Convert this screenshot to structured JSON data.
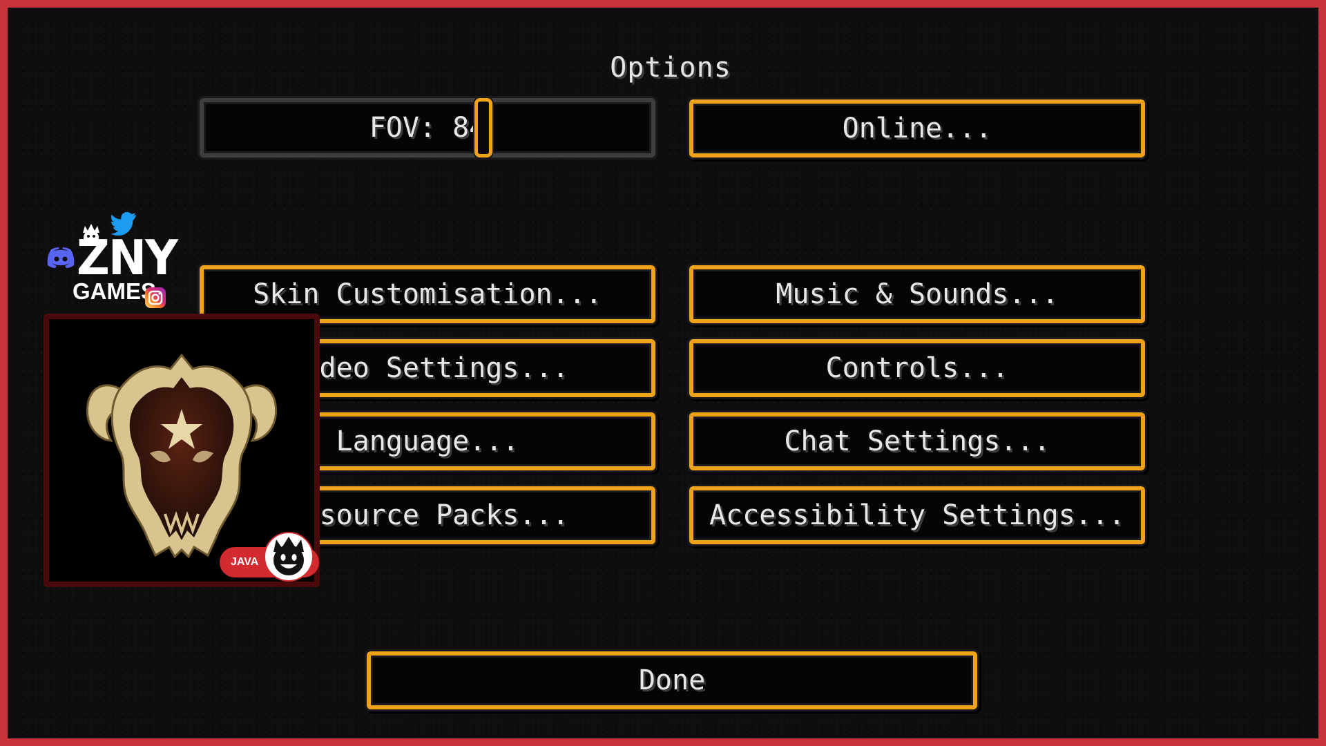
{
  "screen": {
    "title": "Options"
  },
  "fov_slider": {
    "label": "FOV: 84",
    "value": 84,
    "min": 30,
    "max": 110,
    "knob_fraction": 0.63
  },
  "buttons": {
    "online": "Online...",
    "skin": "Skin Customisation...",
    "music": "Music & Sounds...",
    "video": "Video Settings...",
    "controls": "Controls...",
    "language": "Language...",
    "chat": "Chat Settings...",
    "resource": "Resource Packs...",
    "accessibility": "Accessibility Settings...",
    "done": "Done"
  },
  "overlay": {
    "brand_top": "ZNY",
    "brand_bottom": "GAMES",
    "edition_badge": "JAVA"
  },
  "colors": {
    "frame": "#c8343a",
    "button_border": "#f0a21a",
    "slider_border": "#3e3e3e",
    "text": "#e8e8e8",
    "discord": "#5865f2",
    "twitter": "#1d9bf0",
    "java_badge": "#d22a2e"
  }
}
